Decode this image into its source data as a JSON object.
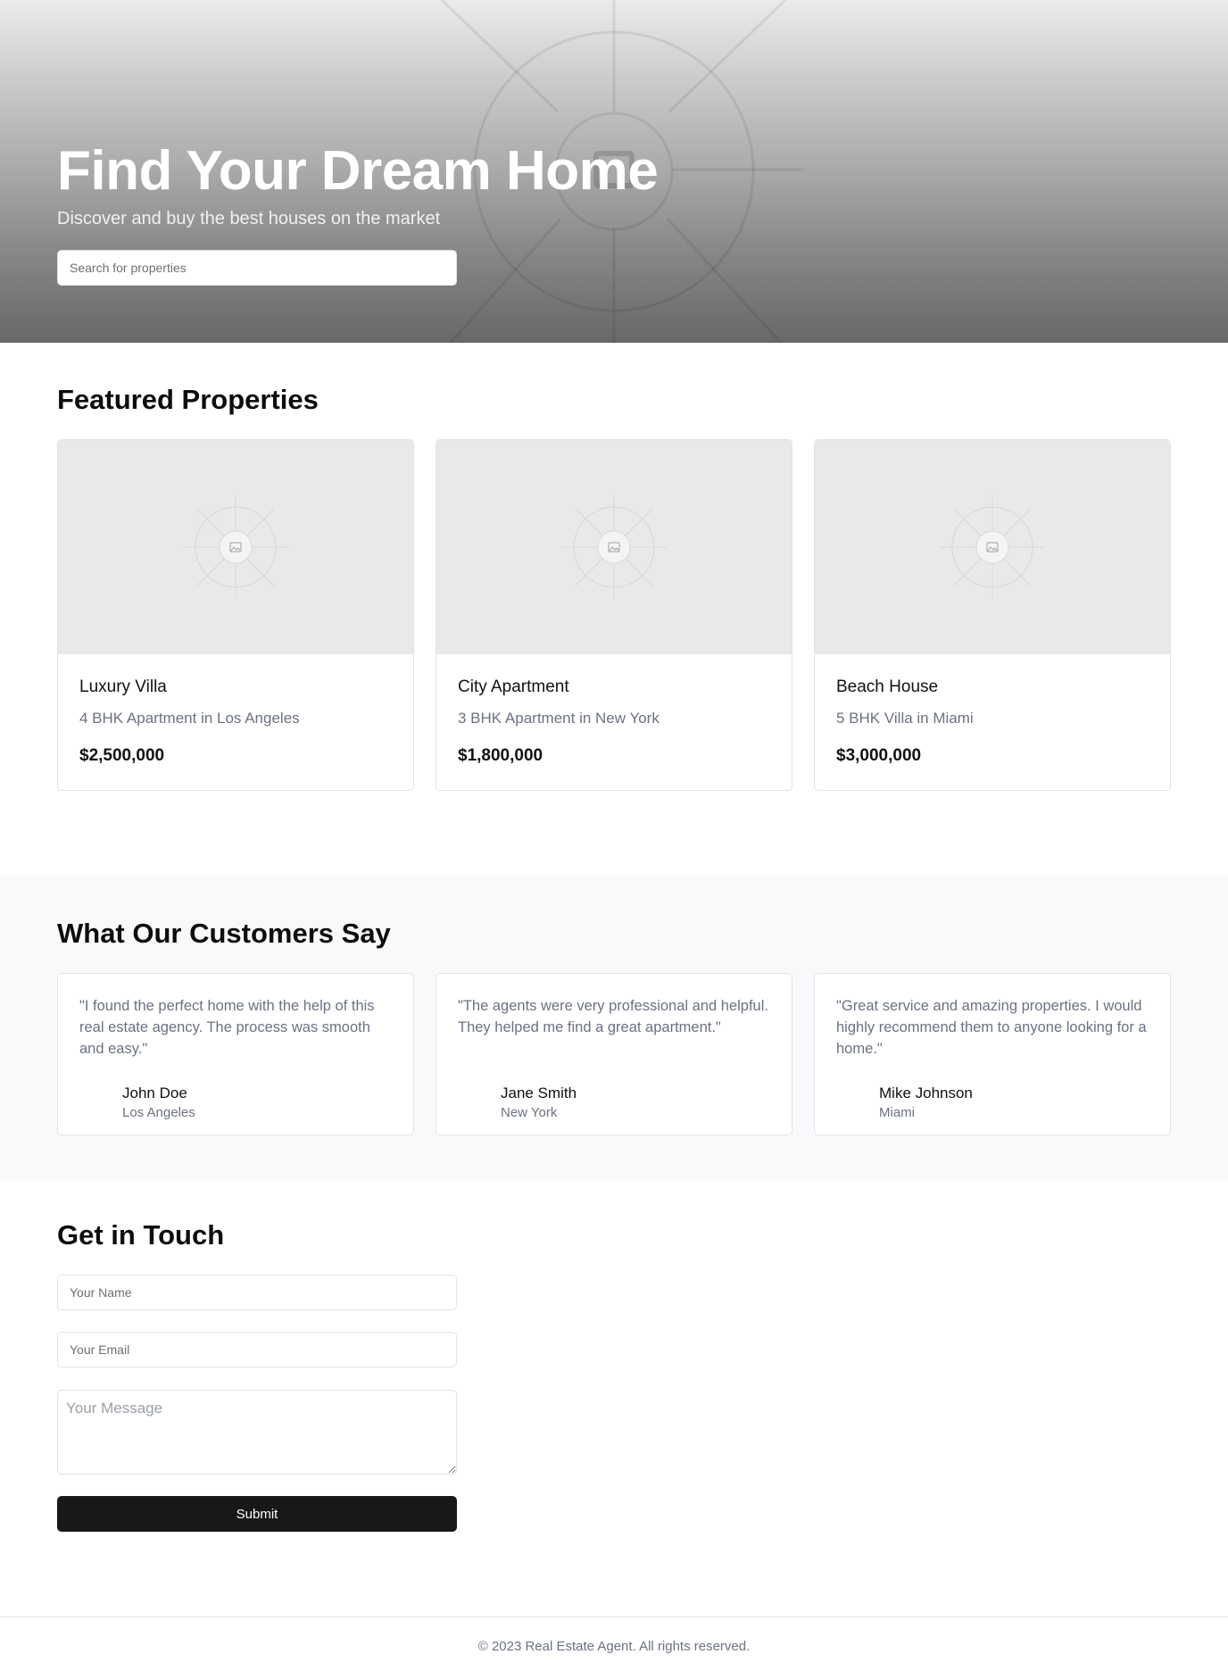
{
  "hero": {
    "title": "Find Your Dream Home",
    "subtitle": "Discover and buy the best houses on the market",
    "search_placeholder": "Search for properties"
  },
  "featured": {
    "heading": "Featured Properties",
    "properties": [
      {
        "title": "Luxury Villa",
        "description": "4 BHK Apartment in Los Angeles",
        "price": "$2,500,000",
        "image_icon": "image-placeholder-icon"
      },
      {
        "title": "City Apartment",
        "description": "3 BHK Apartment in New York",
        "price": "$1,800,000",
        "image_icon": "image-placeholder-icon"
      },
      {
        "title": "Beach House",
        "description": "5 BHK Villa in Miami",
        "price": "$3,000,000",
        "image_icon": "image-placeholder-icon"
      }
    ]
  },
  "testimonials": {
    "heading": "What Our Customers Say",
    "items": [
      {
        "quote": "\"I found the perfect home with the help of this real estate agency. The process was smooth and easy.\"",
        "name": "John Doe",
        "city": "Los Angeles"
      },
      {
        "quote": "\"The agents were very professional and helpful. They helped me find a great apartment.\"",
        "name": "Jane Smith",
        "city": "New York"
      },
      {
        "quote": "\"Great service and amazing properties. I would highly recommend them to anyone looking for a home.\"",
        "name": "Mike Johnson",
        "city": "Miami"
      }
    ]
  },
  "contact": {
    "heading": "Get in Touch",
    "name_placeholder": "Your Name",
    "email_placeholder": "Your Email",
    "message_placeholder": "Your Message",
    "submit_label": "Submit"
  },
  "footer": {
    "copyright": "© 2023 Real Estate Agent. All rights reserved."
  },
  "colors": {
    "primary_button": "#18181b",
    "muted_text": "#6b7280",
    "card_border": "#e2e4e8",
    "testimonials_background": "#f8f9fa",
    "image_placeholder": "#e9e9e9"
  }
}
